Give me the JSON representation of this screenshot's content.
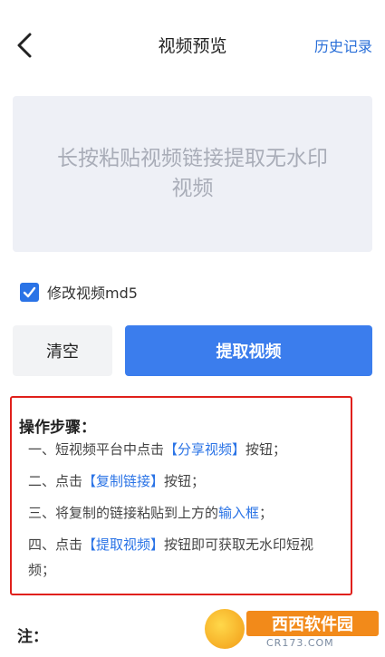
{
  "header": {
    "title": "视频预览",
    "history_label": "历史记录"
  },
  "paste_area": {
    "hint_line1": "长按粘贴视频链接提取无水印",
    "hint_line2": "视频"
  },
  "option": {
    "checked": true,
    "label": "修改视频md5"
  },
  "buttons": {
    "clear_label": "清空",
    "extract_label": "提取视频"
  },
  "steps": {
    "title": "操作步骤：",
    "items": [
      {
        "pre": "一、短视频平台中点击",
        "link": "【分享视频】",
        "post": "按钮；"
      },
      {
        "pre": "二、点击",
        "link": "【复制链接】",
        "post": "按钮；"
      },
      {
        "pre": "三、将复制的链接粘贴到上方的",
        "link": "输入框",
        "post": "；"
      },
      {
        "pre": "四、点击",
        "link": "【提取视频】",
        "post": "按钮即可获取无水印短视频；"
      }
    ]
  },
  "note": {
    "title": "注："
  },
  "watermark": {
    "text": "西西软件园",
    "url": "CR173.COM"
  },
  "colors": {
    "accent": "#3b7ded",
    "link": "#2a73e6",
    "highlight_border": "#e0201b"
  },
  "icons": {
    "back": "chevron-left-icon",
    "checkbox": "checkmark-icon"
  }
}
